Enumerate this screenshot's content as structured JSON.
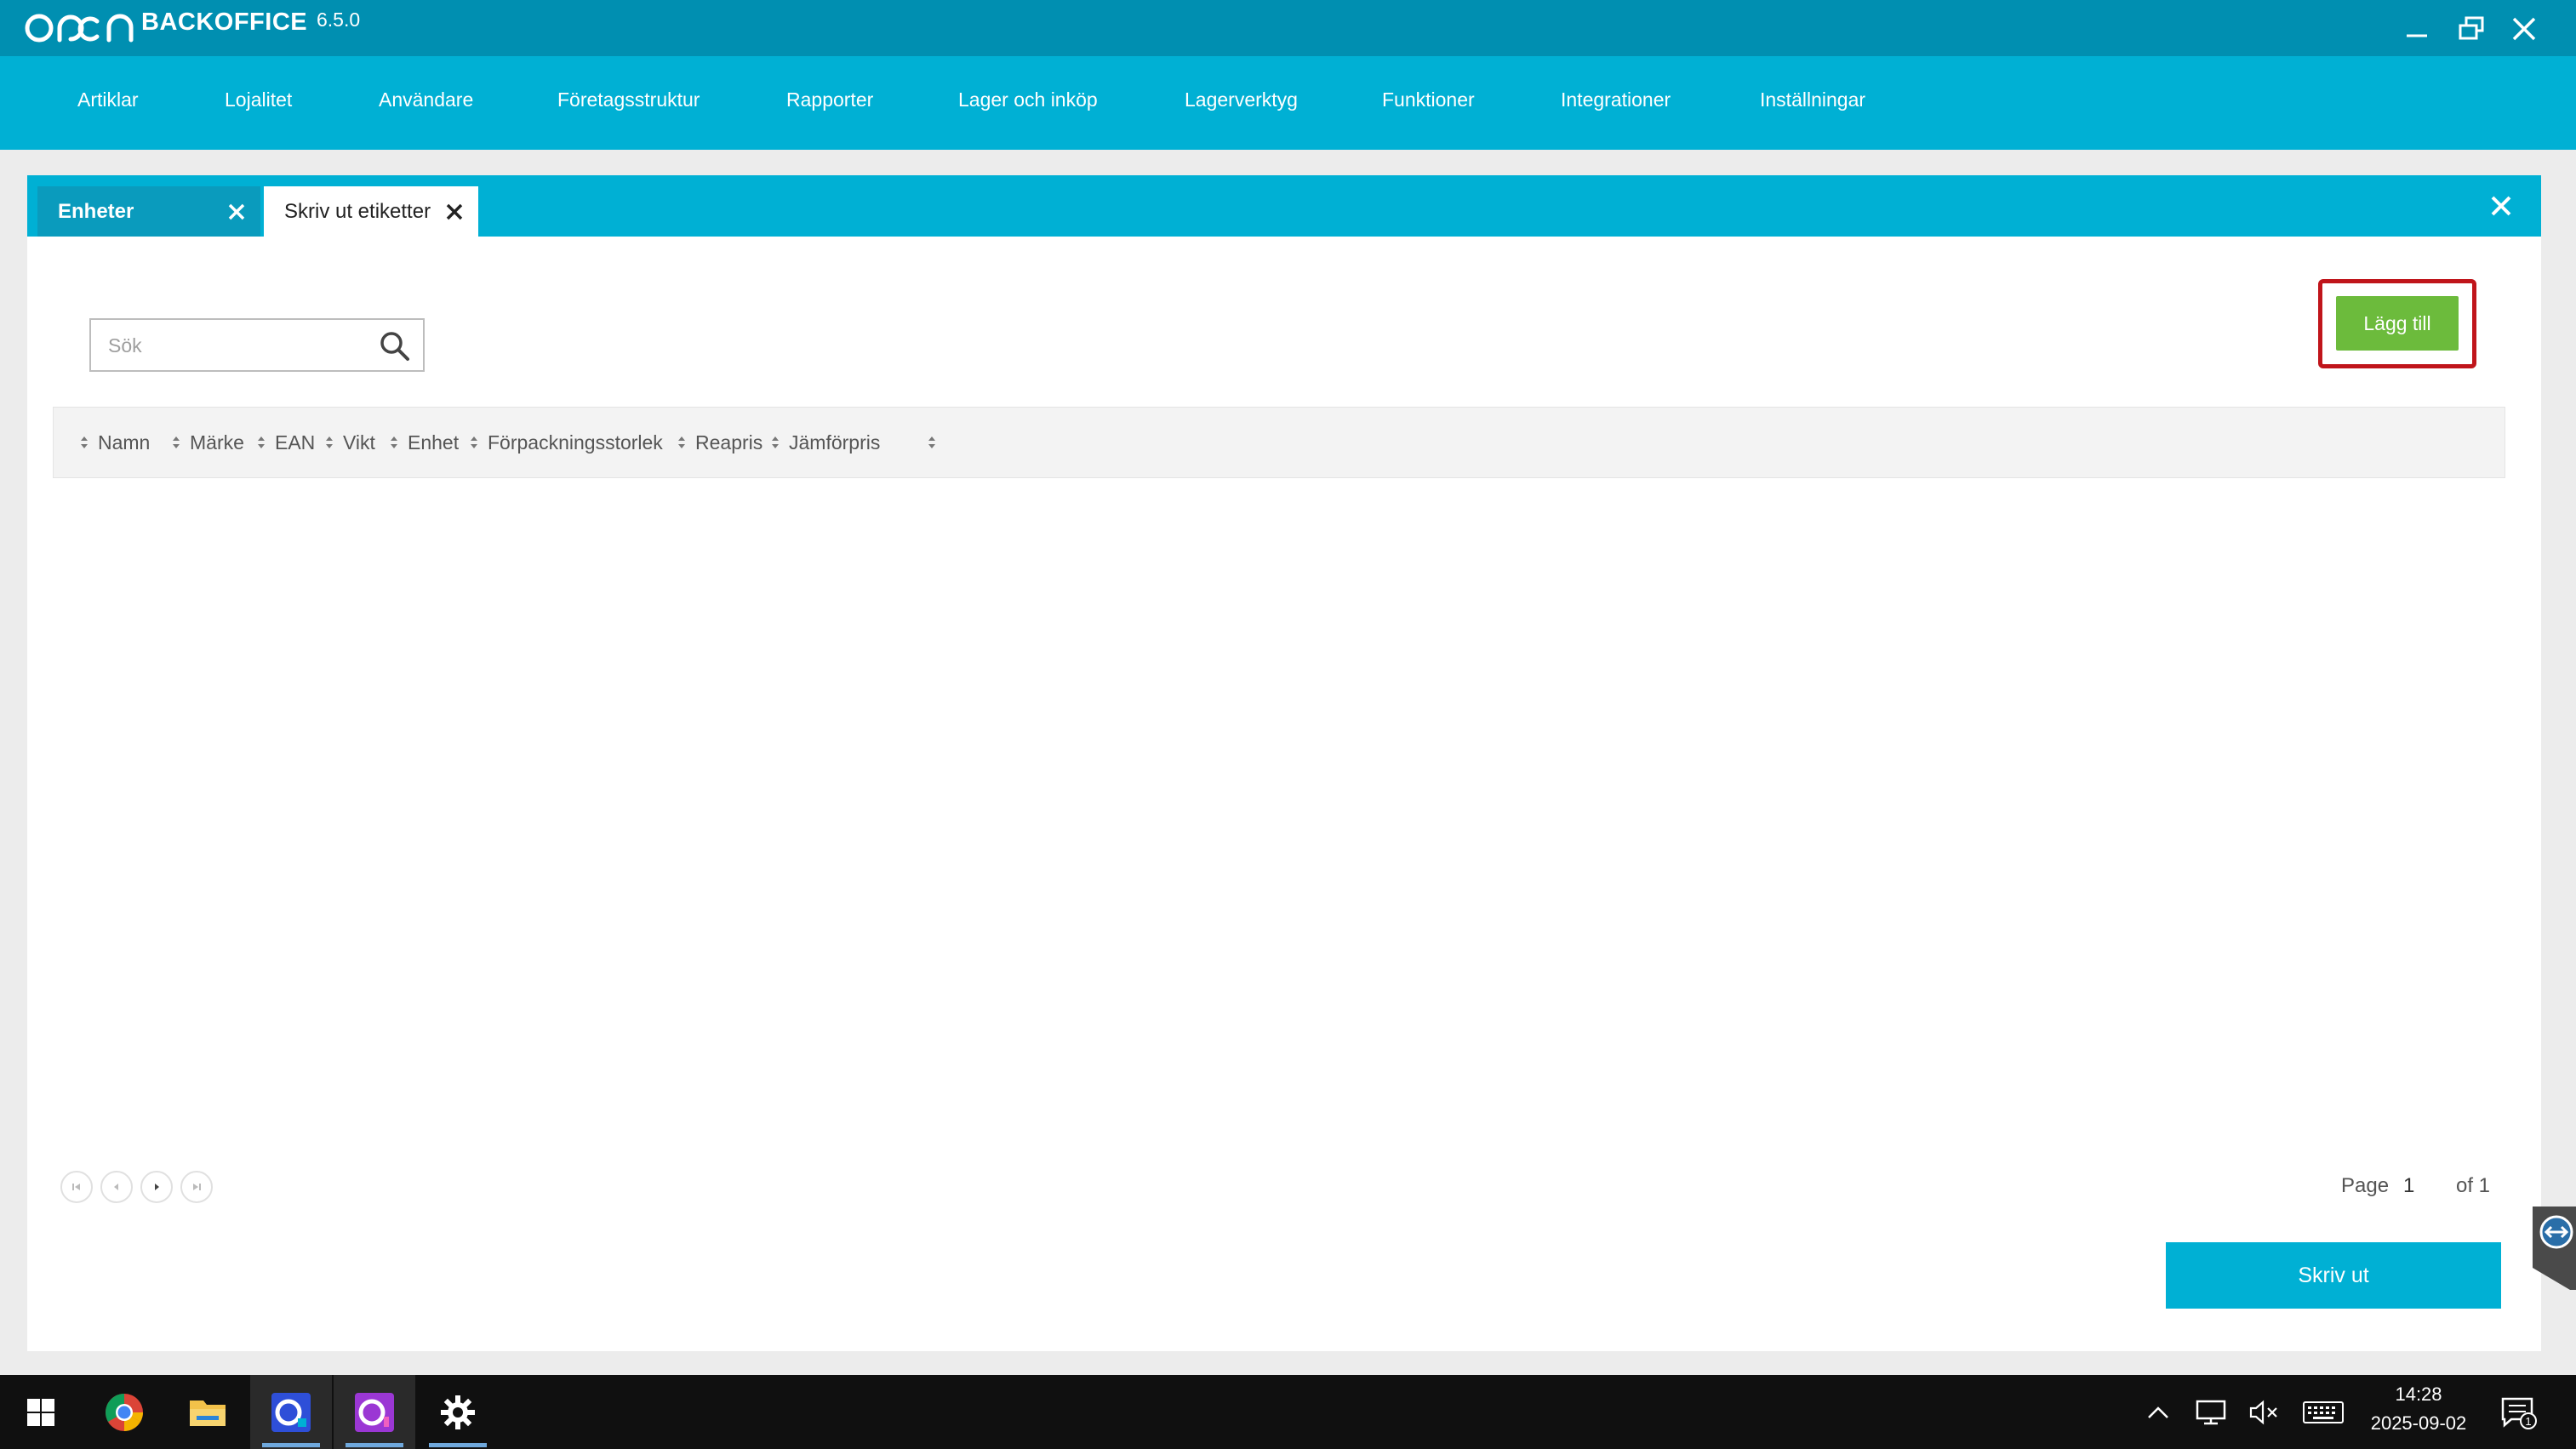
{
  "window": {
    "brand": "BACKOFFICE",
    "version": "6.5.0"
  },
  "nav": {
    "items": [
      "Artiklar",
      "Lojalitet",
      "Användare",
      "Företagsstruktur",
      "Rapporter",
      "Lager och inköp",
      "Lagerverktyg",
      "Funktioner",
      "Integrationer",
      "Inställningar"
    ]
  },
  "tabs": [
    {
      "label": "Enheter",
      "active": false
    },
    {
      "label": "Skriv ut etiketter",
      "active": true
    }
  ],
  "search": {
    "placeholder": "Sök",
    "value": ""
  },
  "actions": {
    "add_label": "Lägg till",
    "print_label": "Skriv ut"
  },
  "table": {
    "columns": [
      "Namn",
      "Märke",
      "EAN",
      "Vikt",
      "Enhet",
      "Förpackningsstorlek",
      "Reapris",
      "Jämförpris"
    ],
    "rows": []
  },
  "pager": {
    "page_label": "Page",
    "current": "1",
    "of_label": "of 1"
  },
  "taskbar": {
    "apps": [
      "start-icon",
      "chrome-icon",
      "file-explorer-icon",
      "open-backoffice-icon",
      "open-backoffice-alt-icon",
      "settings-icon"
    ],
    "time": "14:28",
    "date": "2025-09-02"
  },
  "colors": {
    "title_bar": "#008fb1",
    "nav_bar": "#00b0d4",
    "add_button": "#6cbb3c",
    "highlight": "#c0151b"
  }
}
